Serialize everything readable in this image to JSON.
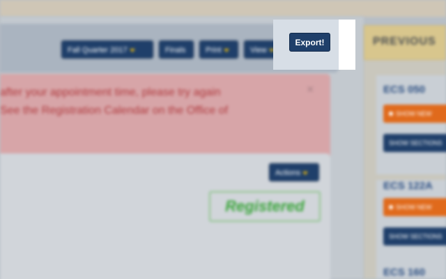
{
  "toolbar": {
    "term_label": "Fall Quarter 2017",
    "finals_label": "Finals",
    "print_label": "Print",
    "view_label": "View",
    "export_label": "Export!"
  },
  "alert": {
    "lines": [
      "after your appointment time, please try again",
      "See the Registration Calendar on the Office of"
    ],
    "close_symbol": "×"
  },
  "course_panel": {
    "actions_label": "Actions",
    "status_badge": "Registered"
  },
  "previous_panel": {
    "title": "PREVIOUS",
    "courses": [
      {
        "code": "ECS 050",
        "orange_label": "SHOW NEW",
        "navy_label": "SHOW SECTIONS"
      },
      {
        "code": "ECS 122A",
        "orange_label": "SHOW NEW",
        "navy_label": "SHOW SECTIONS"
      },
      {
        "code": "ECS 160"
      }
    ]
  },
  "colors": {
    "navy": "#1f3f6a",
    "caret_gold": "#e9b90f",
    "alert_red": "#b03a3e",
    "registered_green": "#3aa53b",
    "orange": "#e06a1c"
  }
}
